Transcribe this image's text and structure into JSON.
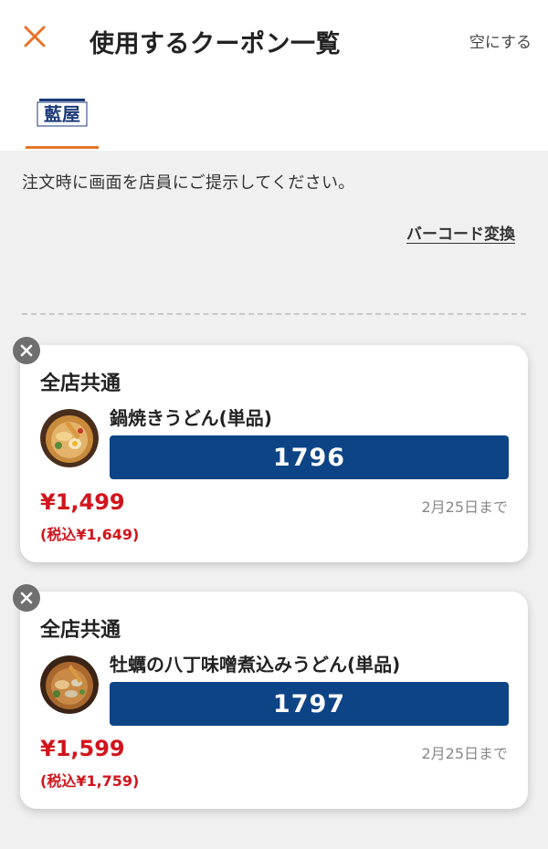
{
  "header": {
    "title": "使用するクーポン一覧",
    "clear_label": "空にする",
    "close_icon": "close-icon"
  },
  "shop_tab": {
    "logo_text": "藍屋",
    "logo_icon": "shop-logo-icon",
    "active": true
  },
  "notice_text": "注文時に画面を店員にご提示してください。",
  "barcode_link": "バーコード変換",
  "coupons": [
    {
      "scope": "全店共通",
      "item_name": "鍋焼きうどん(単品)",
      "code": "1796",
      "price": "¥1,499",
      "tax_price": "(税込¥1,649)",
      "expiry": "2月25日まで"
    },
    {
      "scope": "全店共通",
      "item_name": "牡蠣の八丁味噌煮込みうどん(単品)",
      "code": "1797",
      "price": "¥1,599",
      "tax_price": "(税込¥1,759)",
      "expiry": "2月25日まで"
    }
  ],
  "colors": {
    "accent": "#e6742a",
    "code_bar": "#0d4486",
    "price": "#d2141c",
    "background": "#f0f0f0"
  }
}
